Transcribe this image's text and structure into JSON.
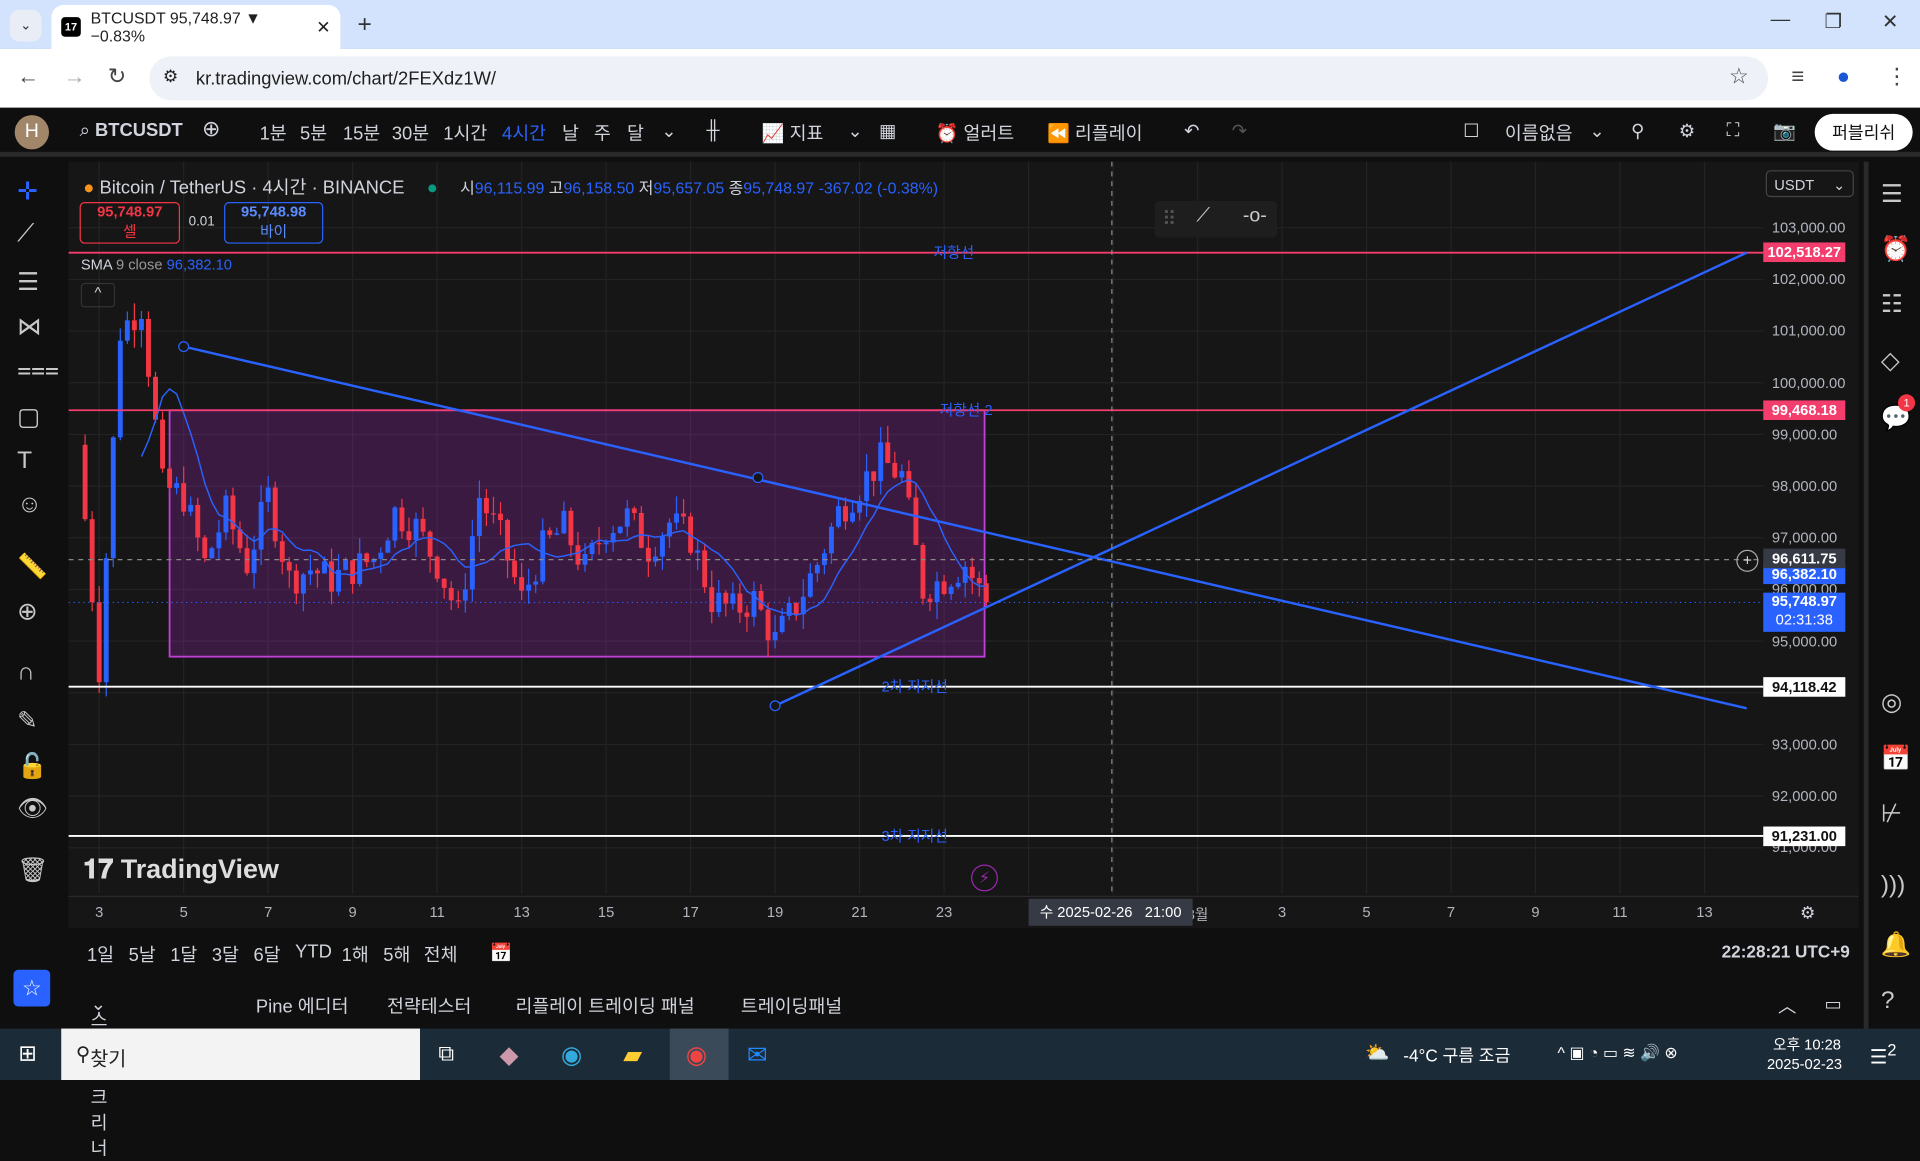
{
  "browser": {
    "tab_title": "BTCUSDT 95,748.97 ▼ −0.83%",
    "url": "kr.tradingview.com/chart/2FEXdz1W/"
  },
  "toolbar": {
    "avatar": "H",
    "symbol": "BTCUSDT",
    "timeframes": [
      "1분",
      "5분",
      "15분",
      "30분",
      "1시간",
      "4시간",
      "날",
      "주",
      "달"
    ],
    "active_timeframe": "4시간",
    "indicators": "지표",
    "alert": "얼러트",
    "replay": "리플레이",
    "layout_name": "이름없음",
    "publish": "퍼블리쉬"
  },
  "legend": {
    "title": "Bitcoin / TetherUS · 4시간 · BINANCE",
    "o_label": "시",
    "o": "96,115.99",
    "h_label": "고",
    "h": "96,158.50",
    "l_label": "저",
    "l": "95,657.05",
    "c_label": "종",
    "c": "95,748.97",
    "change": "-367.02 (-0.38%)",
    "sell_price": "95,748.97",
    "sell_label": "셀",
    "spread": "0.01",
    "buy_price": "95,748.98",
    "buy_label": "바이",
    "sma_label": "SMA",
    "sma_params": "9 close",
    "sma_value": "96,382.10"
  },
  "currency": "USDT",
  "price_ticks": [
    "103,000.00",
    "102,000.00",
    "101,000.00",
    "100,000.00",
    "99,000.00",
    "98,000.00",
    "97,000.00",
    "96,000.00",
    "95,000.00",
    "93,000.00",
    "92,000.00",
    "91,000.00"
  ],
  "price_labels": {
    "resistance1": "102,518.27",
    "resistance2": "99,468.18",
    "crosshair": "96,611.75",
    "sma": "96,382.10",
    "last": "95,748.97",
    "countdown": "02:31:38",
    "support2": "94,118.42",
    "support3": "91,231.00"
  },
  "drawing_labels": {
    "resistance1": "저항선",
    "resistance2": "저항선 2",
    "support2": "2차 지지선",
    "support3": "3차 지지선"
  },
  "time_ticks": [
    "3",
    "5",
    "7",
    "9",
    "11",
    "13",
    "15",
    "17",
    "19",
    "21",
    "23",
    "3월",
    "3",
    "5",
    "7",
    "9",
    "11",
    "13"
  ],
  "crosshair_time": "수 2025-02-26   21:00",
  "watermark": "TradingView",
  "range_buttons": [
    "1일",
    "5날",
    "1달",
    "3달",
    "6달",
    "YTD",
    "1해",
    "5해",
    "전체"
  ],
  "clock": "22:28:21 UTC+9",
  "bottom_tabs": [
    "스탁 스크리너",
    "Pine 에디터",
    "전략테스터",
    "리플레이 트레이딩 패널",
    "트레이딩패널"
  ],
  "notification_count": "1",
  "taskbar": {
    "search": "찾기",
    "weather": "-4°C 구름 조금",
    "time": "오후 10:28",
    "date": "2025-02-23",
    "notif": "2"
  },
  "colors": {
    "up": "#2962ff",
    "down": "#f23645",
    "resistance": "#f23d6d",
    "support": "#ffffff",
    "trend": "#2962ff",
    "box": "#9c27b0"
  },
  "chart_data": {
    "type": "candlestick",
    "symbol": "BTCUSDT",
    "interval": "4h",
    "ylim": [
      90800,
      103600
    ],
    "closes_half_day": {
      "start": "2025-02-02 12:00",
      "values": [
        98800,
        94500,
        101000,
        101500,
        98000,
        97800,
        96500,
        97500,
        96500,
        97800,
        96200,
        96400,
        96200,
        96400,
        96600,
        97500,
        97200,
        96500,
        95500,
        97800,
        97000,
        95800,
        96800,
        97200,
        96400,
        97200,
        97400,
        96800,
        97300,
        97000,
        95800,
        95600,
        95800,
        95000,
        95700,
        96500,
        97500,
        98000,
        98500,
        98200,
        96000,
        96200,
        96500,
        95748.97
      ]
    },
    "horizontal_lines": [
      102518.27,
      99468.18,
      94118.42,
      91231.0
    ],
    "rectangle": {
      "from": "2025-02-04 16:00",
      "to": "2025-02-23 23:00",
      "top": 99468.18,
      "bottom": 94700
    },
    "trendlines": [
      {
        "from": [
          "2025-02-05 00:00",
          100700
        ],
        "to": [
          "2025-03-14 00:00",
          93700
        ]
      },
      {
        "from": [
          "2025-02-19 00:00",
          93750
        ],
        "to": [
          "2025-03-14 00:00",
          102518.27
        ]
      }
    ]
  }
}
